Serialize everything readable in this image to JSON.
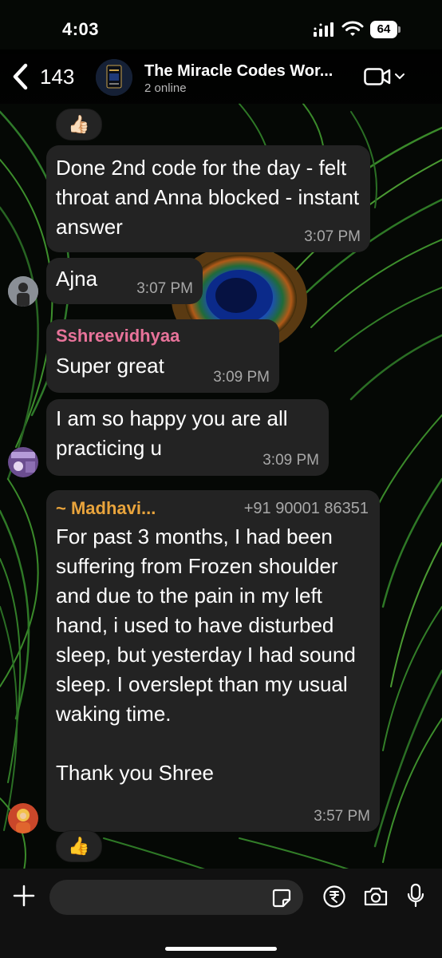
{
  "status_bar": {
    "time": "4:03",
    "battery": "64"
  },
  "header": {
    "back_count": "143",
    "group_name": "The Miracle Codes Wor...",
    "subtitle": "2 online"
  },
  "messages": [
    {
      "text": "Done 2nd code for the day - felt throat and Anna blocked - instant answer",
      "time": "3:07 PM",
      "reaction": "👍🏻"
    },
    {
      "text": "Ajna",
      "time": "3:07 PM"
    },
    {
      "sender": "Sshreevidhyaa",
      "sender_color": "#e8739a",
      "text": "Super great",
      "time": "3:09 PM"
    },
    {
      "text": "I am so happy you are all practicing u",
      "time": "3:09 PM"
    },
    {
      "sender": "~ Madhavi...",
      "sender_color": "#e9a43c",
      "phone": "+91 90001 86351",
      "text": "For past 3 months, I had been suffering from Frozen shoulder and due to the pain in my left hand, i used to have disturbed sleep, but yesterday I had sound sleep. I overslept than my usual waking time.\n\nThank you Shree",
      "time": "3:57 PM",
      "reaction": "👍"
    }
  ],
  "composer": {
    "placeholder": ""
  },
  "colors": {
    "bubble": "#232323",
    "background": "#050805",
    "composer": "#111111"
  }
}
